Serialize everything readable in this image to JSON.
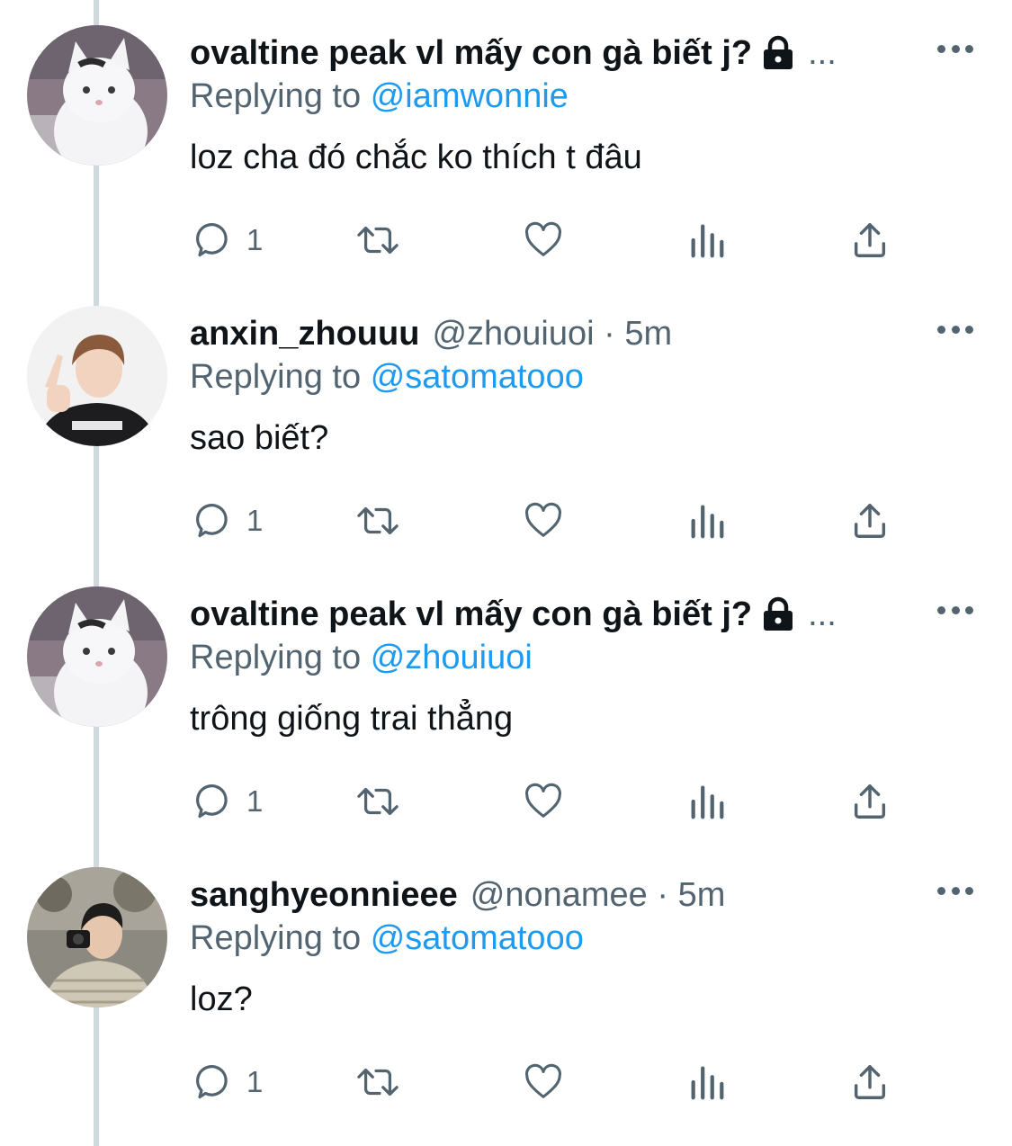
{
  "tweets": [
    {
      "name": "ovaltine peak vl mấy con gà biết j?",
      "locked": true,
      "meta": "...",
      "replying_label": "Replying to",
      "replying_handle": "@iamwonnie",
      "text": "loz cha đó chắc ko thích t đâu",
      "reply_count": "1",
      "avatar": "white-cat-avatar"
    },
    {
      "name": "anxin_zhouuu",
      "locked": false,
      "meta": "@zhouiuoi · 5m",
      "replying_label": "Replying to",
      "replying_handle": "@satomatooo",
      "text": "sao biết?",
      "reply_count": "1",
      "avatar": "person-avatar"
    },
    {
      "name": "ovaltine peak vl mấy con gà biết j?",
      "locked": true,
      "meta": "...",
      "replying_label": "Replying to",
      "replying_handle": "@zhouiuoi",
      "text": "trông giống trai thẳng",
      "reply_count": "1",
      "avatar": "white-cat-avatar"
    },
    {
      "name": "sanghyeonnieee",
      "locked": false,
      "meta": "@nonamee · 5m",
      "replying_label": "Replying to",
      "replying_handle": "@satomatooo",
      "text": "loz?",
      "reply_count": "1",
      "avatar": "person-outdoor-avatar"
    }
  ],
  "colors": {
    "text": "#0f1419",
    "secondary": "#536471",
    "link": "#1d9bf0",
    "thread_line": "#cfd9de"
  },
  "icons": [
    "reply-icon",
    "retweet-icon",
    "like-icon",
    "views-icon",
    "share-icon",
    "more-icon",
    "lock-icon"
  ]
}
